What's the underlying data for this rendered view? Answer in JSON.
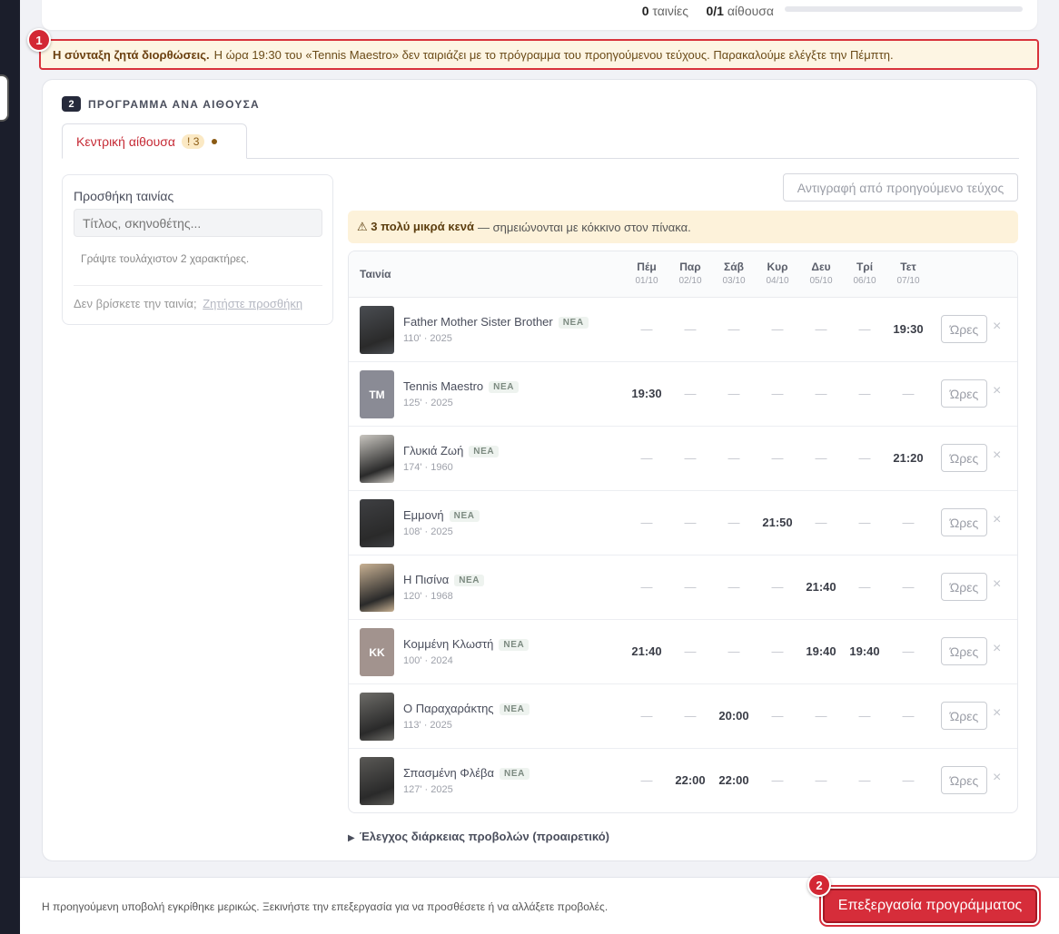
{
  "summary": {
    "films_count": "0",
    "films_label": "ταινίες",
    "rooms_count": "0/1",
    "rooms_label": "αίθουσα",
    "progress": 0
  },
  "alert": {
    "badge": "1",
    "title": "Η σύνταξη ζητά διορθώσεις.",
    "message": "Η ώρα 19:30 του «Tennis Maestro» δεν ταιριάζει με το πρόγραμμα του προηγούμενου τεύχους. Παρακαλούμε ελέγξτε την Πέμπτη."
  },
  "section": {
    "number": "2",
    "title": "ΠΡΟΓΡΑΜΜΑ ΑΝΑ ΑΙΘΟΥΣΑ",
    "tab": {
      "label": "Κεντρική αίθουσα",
      "count": "! 3"
    }
  },
  "add_film": {
    "title": "Προσθήκη ταινίας",
    "placeholder": "Τίτλος, σκηνοθέτης...",
    "hint": "Γράψτε τουλάχιστον 2 χαρακτήρες.",
    "footer_text": "Δεν βρίσκετε την ταινία;",
    "footer_link": "Ζητήστε προσθήκη"
  },
  "copy_button": "Αντιγραφή από προηγούμενο τεύχος",
  "warning": {
    "icon": "⚠",
    "bold": "3 πολύ μικρά κενά",
    "text": "— σημειώνονται με κόκκινο στον πίνακα."
  },
  "table": {
    "film_header": "Ταινία",
    "days": [
      {
        "name": "Πέμ",
        "date": "01/10"
      },
      {
        "name": "Παρ",
        "date": "02/10"
      },
      {
        "name": "Σάβ",
        "date": "03/10"
      },
      {
        "name": "Κυρ",
        "date": "04/10"
      },
      {
        "name": "Δευ",
        "date": "05/10"
      },
      {
        "name": "Τρί",
        "date": "06/10"
      },
      {
        "name": "Τετ",
        "date": "07/10"
      }
    ],
    "empty_mark": "—",
    "hours_label": "Ώρες",
    "remove_mark": "×",
    "new_badge": "ΝΕΑ",
    "films": [
      {
        "title": "Father Mother Sister Brother",
        "meta": "110' · 2025",
        "poster": "image",
        "poster_color": "#4a4d52",
        "slots": [
          "",
          "",
          "",
          "",
          "",
          "",
          "19:30"
        ]
      },
      {
        "title": "Tennis Maestro",
        "meta": "125' · 2025",
        "poster": "initials",
        "initials": "TM",
        "poster_color": "#8a8b95",
        "slots": [
          "19:30",
          "",
          "",
          "",
          "",
          "",
          ""
        ]
      },
      {
        "title": "Γλυκιά Ζωή",
        "meta": "174' · 1960",
        "poster": "image",
        "poster_color": "#c9c6c0",
        "slots": [
          "",
          "",
          "",
          "",
          "",
          "",
          "21:20"
        ]
      },
      {
        "title": "Εμμονή",
        "meta": "108' · 2025",
        "poster": "image",
        "poster_color": "#3e3f42",
        "slots": [
          "",
          "",
          "",
          "21:50",
          "",
          "",
          ""
        ]
      },
      {
        "title": "Η Πισίνα",
        "meta": "120' · 1968",
        "poster": "image",
        "poster_color": "#c8b193",
        "slots": [
          "",
          "",
          "",
          "",
          "21:40",
          "",
          ""
        ]
      },
      {
        "title": "Κομμένη Κλωστή",
        "meta": "100' · 2024",
        "poster": "initials",
        "initials": "ΚΚ",
        "poster_color": "#a2938e",
        "slots": [
          "21:40",
          "",
          "",
          "",
          "19:40",
          "19:40",
          ""
        ]
      },
      {
        "title": "Ο Παραχαράκτης",
        "meta": "113' · 2025",
        "poster": "image",
        "poster_color": "#6d6c68",
        "slots": [
          "",
          "",
          "20:00",
          "",
          "",
          "",
          ""
        ]
      },
      {
        "title": "Σπασμένη Φλέβα",
        "meta": "127' · 2025",
        "poster": "image",
        "poster_color": "#5a5956",
        "slots": [
          "",
          "22:00",
          "22:00",
          "",
          "",
          "",
          ""
        ]
      }
    ]
  },
  "duration_check": "Έλεγχος διάρκειας προβολών (προαιρετικό)",
  "footer": {
    "text": "Η προηγούμενη υποβολή εγκρίθηκε μερικώς. Ξεκινήστε την επεξεργασία για να προσθέσετε ή να αλλάξετε προβολές.",
    "badge": "2",
    "button": "Επεξεργασία προγράμματος"
  }
}
